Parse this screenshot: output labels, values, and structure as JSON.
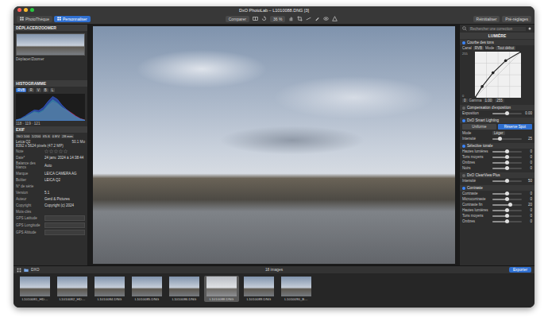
{
  "window": {
    "title": "DxO PhotoLab – L1010088.DNG [3]"
  },
  "tabs": [
    {
      "label": "PhotoThèque",
      "selected": false
    },
    {
      "label": "Personnaliser",
      "selected": true
    }
  ],
  "toolbar": {
    "compare": "Comparer",
    "zoom": "36 %"
  },
  "header_buttons": [
    "Réinitialiser",
    "Pré-réglages"
  ],
  "navigator": {
    "title": "DÉPLACER/ZOOMER",
    "caption": "Déplacer/Zoomer"
  },
  "histogram": {
    "title": "HISTOGRAMME",
    "channels": [
      {
        "label": "RVB",
        "selected": true
      },
      {
        "label": "R",
        "selected": false
      },
      {
        "label": "V",
        "selected": false
      },
      {
        "label": "B",
        "selected": false
      },
      {
        "label": "L",
        "selected": false
      }
    ],
    "series": [
      {
        "name": "R",
        "color": "#ff3b3b",
        "values": [
          2,
          5,
          12,
          22,
          30,
          26,
          35,
          55,
          70,
          62,
          48,
          40,
          30,
          18,
          8,
          3
        ]
      },
      {
        "name": "V",
        "color": "#3bd23b",
        "values": [
          2,
          6,
          14,
          24,
          34,
          30,
          40,
          60,
          78,
          66,
          50,
          38,
          26,
          14,
          6,
          2
        ]
      },
      {
        "name": "B",
        "color": "#3b6bff",
        "values": [
          3,
          8,
          18,
          30,
          40,
          38,
          50,
          72,
          90,
          80,
          58,
          42,
          28,
          16,
          7,
          2
        ]
      }
    ],
    "readout": "118 · 119 · 121"
  },
  "exif": {
    "title": "EXIF",
    "summary": [
      "ISO 100",
      "1/200",
      "f/5.6",
      "0 EV",
      "28 mm"
    ],
    "camera": "Leica Q2",
    "filesize": "50.1 Mo",
    "dimensions": "8392 x 5624 pixels (47.2 MP)",
    "rows": [
      {
        "label": "Note",
        "kind": "stars",
        "stars": 0,
        "value": ""
      },
      {
        "label": "Date*",
        "kind": "text",
        "value": "24 janv. 2024 à 14:38:44"
      },
      {
        "label": "Balance des blancs",
        "kind": "text",
        "value": "Auto"
      },
      {
        "label": "Marque",
        "kind": "text",
        "value": "LEICA CAMERA AG"
      },
      {
        "label": "Boîtier",
        "kind": "text",
        "value": "LEICA Q2"
      },
      {
        "label": "N° de série",
        "kind": "text",
        "value": ""
      },
      {
        "label": "Version",
        "kind": "text",
        "value": "5.1"
      },
      {
        "label": "Auteur",
        "kind": "text",
        "value": "Gerd & Pictures"
      },
      {
        "label": "Copyright",
        "kind": "text",
        "value": "Copyright (c) 2024"
      },
      {
        "label": "Mots-clés",
        "kind": "text",
        "value": ""
      },
      {
        "label": "GPS Latitude",
        "kind": "field",
        "value": ""
      },
      {
        "label": "GPS Longitude",
        "kind": "field",
        "value": ""
      },
      {
        "label": "GPS Altitude",
        "kind": "field",
        "value": ""
      }
    ]
  },
  "right_panel": {
    "search_placeholder": "Rechercher une correction",
    "title": "LUMIÈRE",
    "sections": [
      {
        "title": "Courbe des tons",
        "enabled": true,
        "rows": [
          {
            "kind": "selects",
            "items": [
              {
                "label": "Canal",
                "value": "RVB"
              },
              {
                "label": "Mode",
                "value": "Tout début"
              }
            ]
          },
          {
            "kind": "curve",
            "points": [
              [
                0,
                0
              ],
              [
                40,
                62
              ],
              [
                100,
                138
              ],
              [
                170,
                205
              ],
              [
                255,
                255
              ]
            ],
            "out_max": "255",
            "out_min": "0",
            "in_min": "0",
            "in_max": "255",
            "gamma_label": "Gamma",
            "gamma": "1.00"
          }
        ]
      },
      {
        "title": "Compensation d'exposition",
        "enabled": false,
        "rows": [
          {
            "kind": "slider",
            "label": "Exposition",
            "value": "0.00",
            "level": 0.5
          }
        ]
      },
      {
        "title": "DxO Smart Lighting",
        "enabled": true,
        "rows": [
          {
            "kind": "buttons",
            "options": [
              {
                "label": "Uniforme",
                "selected": false
              },
              {
                "label": "Réserve Spot",
                "selected": true
              }
            ]
          },
          {
            "kind": "select",
            "label": "Mode",
            "value": "Léger"
          },
          {
            "kind": "slider",
            "label": "Intensité",
            "value": "25",
            "level": 0.25
          }
        ]
      },
      {
        "title": "Sélective tonale",
        "enabled": true,
        "rows": [
          {
            "kind": "slider",
            "label": "Hautes lumières",
            "value": "0",
            "level": 0.5
          },
          {
            "kind": "slider",
            "label": "Tons moyens",
            "value": "0",
            "level": 0.5
          },
          {
            "kind": "slider",
            "label": "Ombres",
            "value": "0",
            "level": 0.5
          },
          {
            "kind": "slider",
            "label": "Noirs",
            "value": "0",
            "level": 0.5
          }
        ]
      },
      {
        "title": "DxO ClearView Plus",
        "enabled": false,
        "rows": [
          {
            "kind": "slider",
            "label": "Intensité",
            "value": "50",
            "level": 0.5
          }
        ]
      },
      {
        "title": "Contraste",
        "enabled": true,
        "rows": [
          {
            "kind": "slider",
            "label": "Contraste",
            "value": "0",
            "level": 0.5
          },
          {
            "kind": "slider",
            "label": "Microcontraste",
            "value": "0",
            "level": 0.5
          },
          {
            "kind": "slider",
            "label": "Contraste fin",
            "value": "20",
            "level": 0.6
          },
          {
            "kind": "slider",
            "label": "Hautes lumières",
            "value": "0",
            "level": 0.5
          },
          {
            "kind": "slider",
            "label": "Tons moyens",
            "value": "0",
            "level": 0.5
          },
          {
            "kind": "slider",
            "label": "Ombres",
            "value": "0",
            "level": 0.5
          }
        ]
      }
    ]
  },
  "filmstrip": {
    "path": "DXO",
    "count": "18 images",
    "export": "Exporter",
    "thumbs": [
      {
        "label": "L1010081_HD…",
        "selected": false
      },
      {
        "label": "L1010082_HD…",
        "selected": false
      },
      {
        "label": "L1010084.DNG",
        "selected": false
      },
      {
        "label": "L1010085.DNG",
        "selected": false
      },
      {
        "label": "L1010086.DNG",
        "selected": false
      },
      {
        "label": "L1010088.DNG",
        "selected": true
      },
      {
        "label": "L1010089.DNG",
        "selected": false
      },
      {
        "label": "L1010090_B…",
        "selected": false
      }
    ]
  }
}
